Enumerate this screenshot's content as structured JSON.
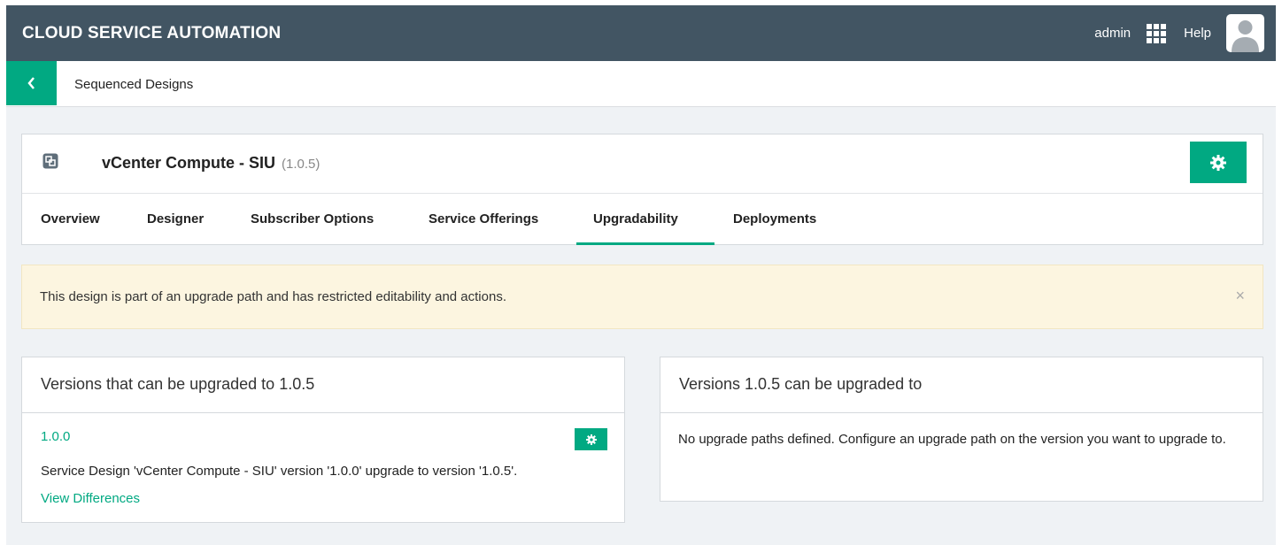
{
  "header": {
    "app_title": "CLOUD SERVICE AUTOMATION",
    "user": "admin",
    "help": "Help",
    "icons": {
      "apps": "grid-icon",
      "avatar": "user-avatar-icon"
    }
  },
  "breadcrumb": {
    "back_icon": "chevron-left-icon",
    "label": "Sequenced Designs"
  },
  "design": {
    "name": "vCenter Compute - SIU",
    "version": "(1.0.5)",
    "icon": "design-icon",
    "settings_icon": "gear-icon"
  },
  "tabs": [
    {
      "label": "Overview"
    },
    {
      "label": "Designer"
    },
    {
      "label": "Subscriber Options"
    },
    {
      "label": "Service Offerings"
    },
    {
      "label": "Upgradability",
      "active": true
    },
    {
      "label": "Deployments"
    }
  ],
  "alert": {
    "message": "This design is part of an upgrade path and has restricted editability and actions.",
    "close": "×"
  },
  "upgrade_from": {
    "title": "Versions that can be upgraded to 1.0.5",
    "items": [
      {
        "version": "1.0.0",
        "description": "Service Design 'vCenter Compute - SIU' version '1.0.0' upgrade to version '1.0.5'.",
        "link": "View Differences"
      }
    ]
  },
  "upgrade_to": {
    "title": "Versions 1.0.5 can be upgraded to",
    "message": "No upgrade paths defined. Configure an upgrade path on the version you want to upgrade to."
  },
  "colors": {
    "brand": "#01a982",
    "topbar": "#425563",
    "alert_bg": "#fcf5e0"
  }
}
